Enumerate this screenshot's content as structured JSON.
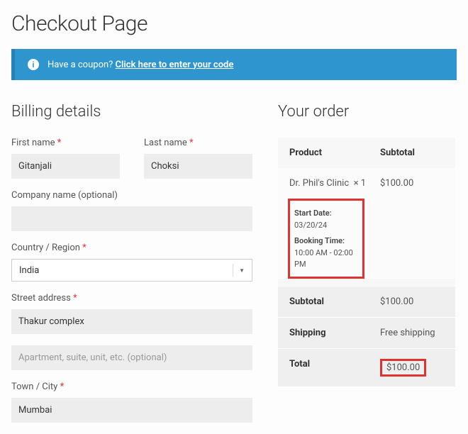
{
  "page_title": "Checkout Page",
  "coupon": {
    "prompt": "Have a coupon?",
    "link_text": "Click here to enter your code"
  },
  "billing": {
    "heading": "Billing details",
    "first_name": {
      "label": "First name",
      "value": "Gitanjali"
    },
    "last_name": {
      "label": "Last name",
      "value": "Choksi"
    },
    "company": {
      "label": "Company name (optional)",
      "value": ""
    },
    "country": {
      "label": "Country / Region",
      "value": "India"
    },
    "street": {
      "label": "Street address",
      "value": "Thakur complex",
      "placeholder2": "Apartment, suite, unit, etc. (optional)",
      "value2": ""
    },
    "city": {
      "label": "Town / City",
      "value": "Mumbai"
    },
    "required_marker": "*"
  },
  "order": {
    "heading": "Your order",
    "head_product": "Product",
    "head_subtotal": "Subtotal",
    "item": {
      "name": "Dr. Phil's Clinic",
      "qty": "× 1",
      "price": "$100.00",
      "start_date_label": "Start Date:",
      "start_date": "03/20/24",
      "booking_time_label": "Booking Time:",
      "booking_time": "10:00 AM - 02:00 PM"
    },
    "subtotal_label": "Subtotal",
    "subtotal_value": "$100.00",
    "shipping_label": "Shipping",
    "shipping_value": "Free shipping",
    "total_label": "Total",
    "total_value": "$100.00"
  }
}
